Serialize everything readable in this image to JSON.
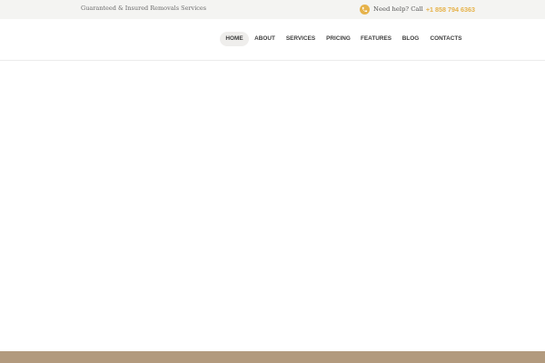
{
  "topbar": {
    "tagline": "Guaranteed & Insured Removals Services",
    "help_label": "Need help? Call",
    "phone_number": "+1 858 794 6363",
    "phone_icon": "phone-icon"
  },
  "nav": {
    "items": [
      {
        "label": "HOME",
        "active": true
      },
      {
        "label": "ABOUT",
        "active": false
      },
      {
        "label": "SERVICES",
        "active": false
      },
      {
        "label": "PRICING",
        "active": false
      },
      {
        "label": "FEATURES",
        "active": false
      },
      {
        "label": "BLOG",
        "active": false
      },
      {
        "label": "CONTACTS",
        "active": false
      }
    ]
  },
  "colors": {
    "accent": "#e6b24a",
    "topbar_bg": "#f4f4f2",
    "footer_strip": "#b29a7e"
  }
}
